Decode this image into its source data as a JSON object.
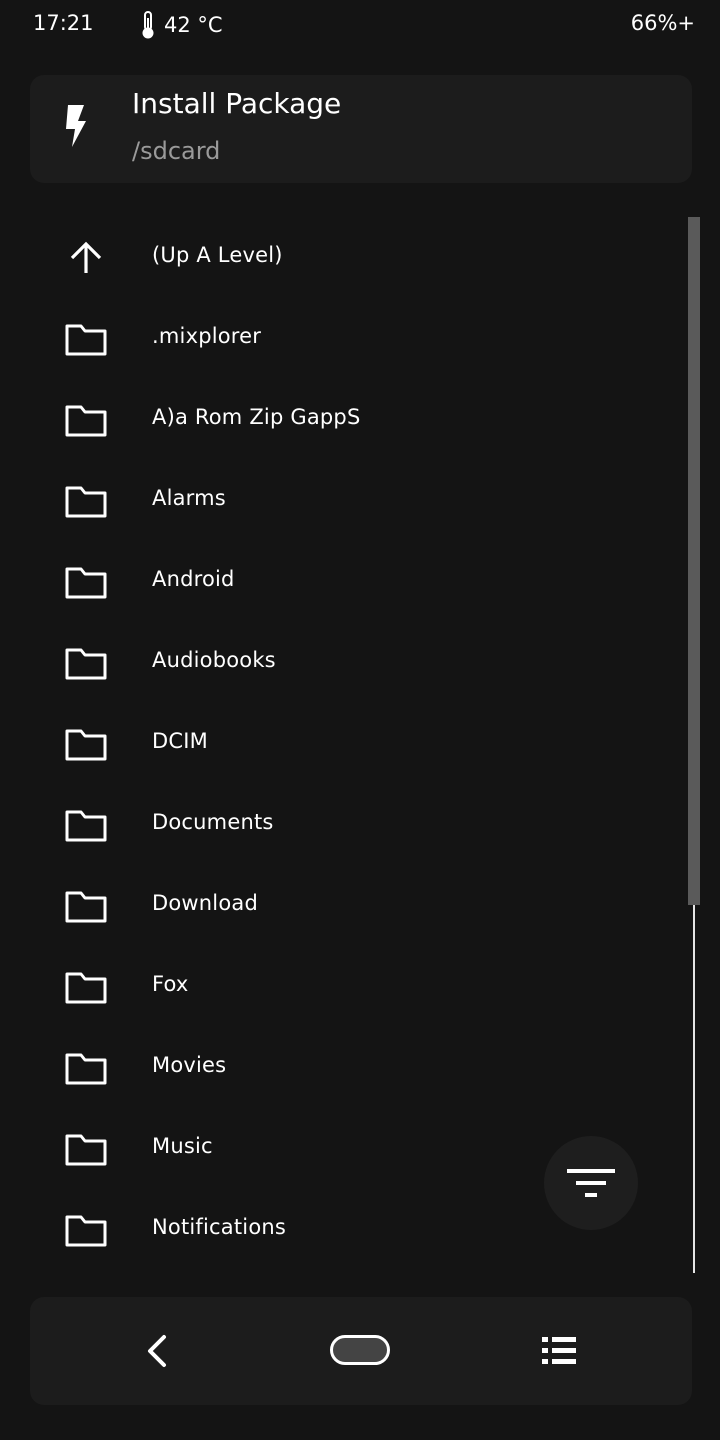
{
  "status_bar": {
    "time": "17:21",
    "temperature": "42 °C",
    "battery": "66%+"
  },
  "header": {
    "title": "Install Package",
    "path": "/sdcard",
    "icon": "flash-icon"
  },
  "files": [
    {
      "label": "(Up A Level)",
      "icon": "arrow-up-icon"
    },
    {
      "label": ".mixplorer",
      "icon": "folder-icon"
    },
    {
      "label": "A)a Rom Zip GappS",
      "icon": "folder-icon"
    },
    {
      "label": "Alarms",
      "icon": "folder-icon"
    },
    {
      "label": "Android",
      "icon": "folder-icon"
    },
    {
      "label": "Audiobooks",
      "icon": "folder-icon"
    },
    {
      "label": "DCIM",
      "icon": "folder-icon"
    },
    {
      "label": "Documents",
      "icon": "folder-icon"
    },
    {
      "label": "Download",
      "icon": "folder-icon"
    },
    {
      "label": "Fox",
      "icon": "folder-icon"
    },
    {
      "label": "Movies",
      "icon": "folder-icon"
    },
    {
      "label": "Music",
      "icon": "folder-icon"
    },
    {
      "label": "Notifications",
      "icon": "folder-icon"
    }
  ],
  "fab": {
    "icon": "filter-icon"
  },
  "nav": {
    "back_icon": "back-chevron-icon",
    "home_icon": "home-pill-icon",
    "menu_icon": "list-menu-icon"
  },
  "colors": {
    "background": "#141414",
    "card": "#1c1c1c",
    "text": "#ffffff",
    "subtext": "#9a9a9a",
    "scroll_thumb": "#5a5a5a"
  }
}
